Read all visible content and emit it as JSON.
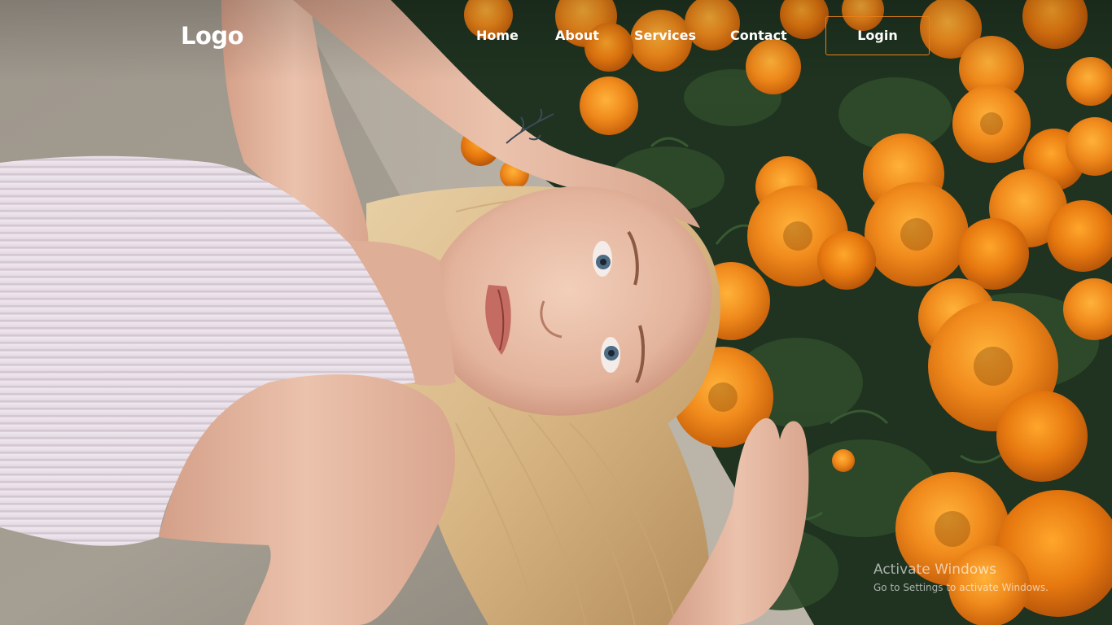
{
  "nav": {
    "logo": "Logo",
    "links": [
      "Home",
      "About",
      "Services",
      "Contact"
    ],
    "login_label": "Login",
    "login_border_color": "#e8801a"
  },
  "hero": {
    "image_description_icon": "portrait-photo"
  },
  "watermark": {
    "title": "Activate Windows",
    "subtitle": "Go to Settings to activate Windows."
  },
  "colors": {
    "text": "#ffffff",
    "accent": "#e8801a",
    "marigold": "#f08a1c",
    "foliage": "#233a1f"
  }
}
